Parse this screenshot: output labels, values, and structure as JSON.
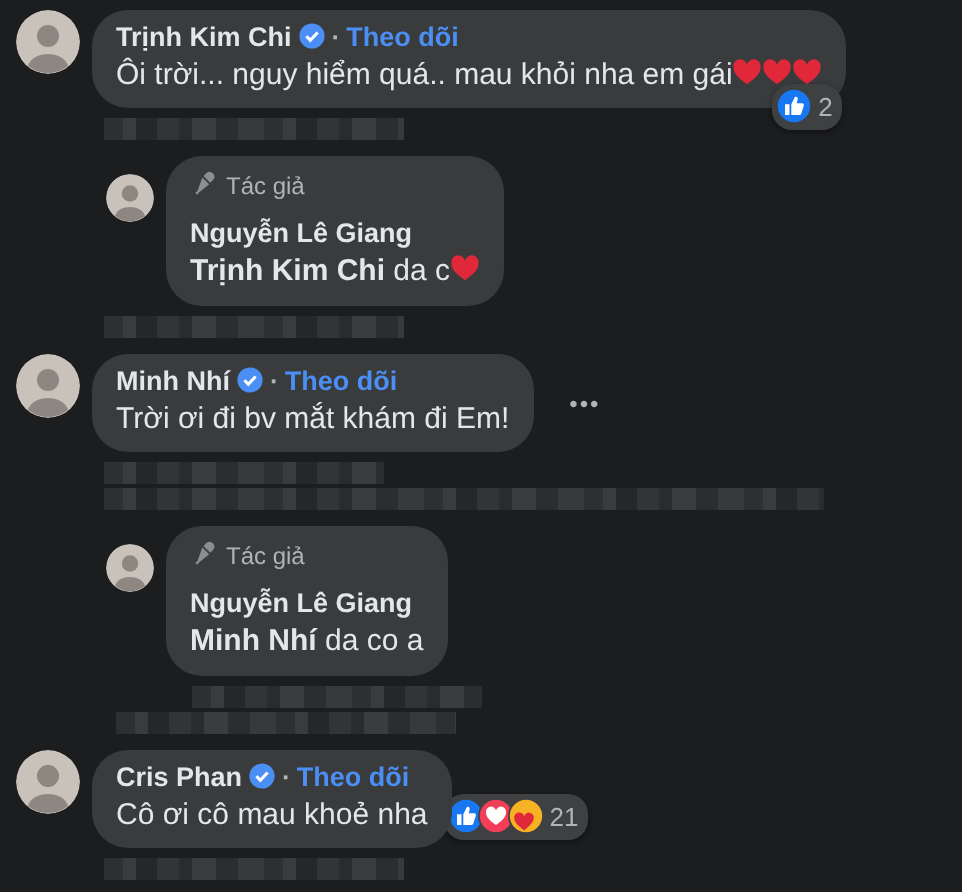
{
  "thread": [
    {
      "kind": "comment",
      "author": "Trịnh Kim Chi",
      "verified": true,
      "separator": "·",
      "follow": "Theo dõi",
      "text": "Ôi trời... nguy hiểm quá.. mau khỏi nha em gái",
      "emoji": [
        {
          "kind": "heart"
        },
        {
          "kind": "heart"
        },
        {
          "kind": "heart"
        }
      ],
      "reactions": {
        "overlaps_bubble": true,
        "types": [
          {
            "kind": "like"
          }
        ],
        "count": "2"
      }
    },
    {
      "kind": "pixelated",
      "lines": [
        {
          "kind": "short"
        }
      ]
    },
    {
      "kind": "reply",
      "badge": "Tác giả",
      "author": "Nguyễn Lê Giang",
      "text": "**Trịnh Kim Chi** da c",
      "emoji": [
        {
          "kind": "heart"
        }
      ]
    },
    {
      "kind": "pixelated",
      "lines": [
        {
          "kind": "short"
        }
      ]
    },
    {
      "kind": "comment",
      "author": "Minh Nhí",
      "verified": true,
      "separator": "·",
      "follow": "Theo dõi",
      "text": "Trời ơi đi bv mắt khám đi Em!",
      "menu": "•••"
    },
    {
      "kind": "pixelated",
      "lines": [
        {
          "kind": "medium"
        },
        {
          "kind": "long"
        }
      ]
    },
    {
      "kind": "reply",
      "badge": "Tác giả",
      "author": "Nguyễn Lê Giang",
      "text": "**Minh Nhí** da co a"
    },
    {
      "kind": "pixelated",
      "lines": [
        {
          "kind": "indented"
        },
        {
          "kind": "wide"
        }
      ]
    },
    {
      "kind": "comment",
      "author": "Cris Phan",
      "verified": true,
      "separator": "·",
      "follow": "Theo dõi",
      "text": "Cô ơi cô mau khoẻ nha",
      "reactions": {
        "overlaps_bubble": false,
        "types": [
          {
            "kind": "like"
          },
          {
            "kind": "love"
          },
          {
            "kind": "care"
          }
        ],
        "count": "21"
      }
    },
    {
      "kind": "pixelated",
      "lines": [
        {
          "kind": "short"
        }
      ]
    }
  ]
}
